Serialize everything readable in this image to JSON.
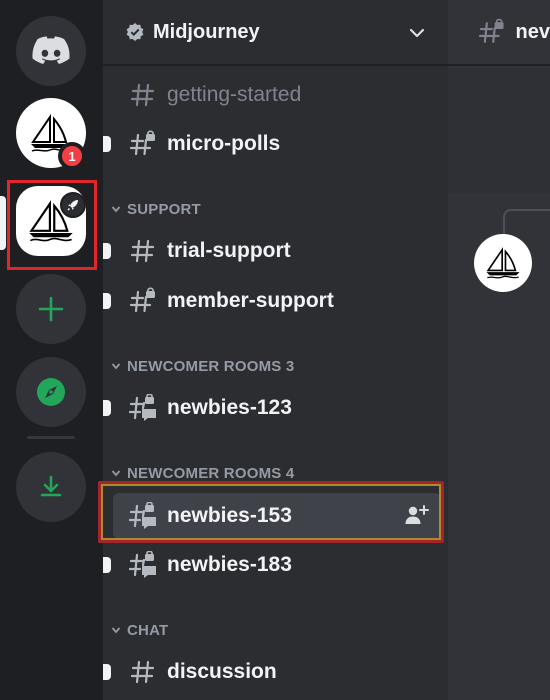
{
  "server": {
    "name": "Midjourney",
    "unread_count": "1"
  },
  "channels": {
    "getting_started": "getting-started",
    "micro_polls": "micro-polls",
    "trial_support": "trial-support",
    "member_support": "member-support",
    "newbies_123": "newbies-123",
    "newbies_153": "newbies-153",
    "newbies_183": "newbies-183",
    "discussion": "discussion"
  },
  "categories": {
    "support": "SUPPORT",
    "newcomer_3": "NEWCOMER ROOMS 3",
    "newcomer_4": "NEWCOMER ROOMS 4",
    "chat": "CHAT"
  },
  "chat_header": {
    "title": "nev"
  },
  "colors": {
    "rail_bg": "#1e1f22",
    "channel_bg": "#2b2d31",
    "chat_bg": "#313338",
    "active_row": "#404249",
    "green_accent": "#23a55a",
    "red_badge": "#f23f43",
    "selection_red": "#e0262b"
  },
  "icons": {
    "home": "discord-logo-icon",
    "add": "plus-icon",
    "explore": "compass-icon",
    "download": "download-icon",
    "channel": "hash-icon",
    "locked_channel": "hash-lock-icon",
    "threaded_channel": "hash-thread-icon",
    "invite": "add-member-icon"
  }
}
